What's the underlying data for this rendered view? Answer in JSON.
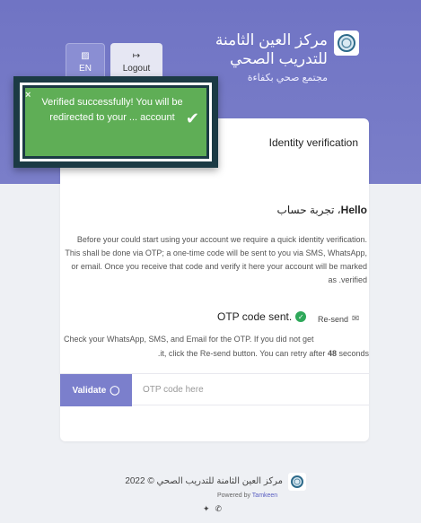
{
  "header": {
    "brand_title": "مركز العين الثامنة للتدريب الصحي",
    "brand_subtitle": "مجتمع صحي بكفاءة",
    "lang_button": "EN",
    "logout_button": "Logout",
    "lang_icon": "translate-icon",
    "logout_icon": "logout-icon"
  },
  "toast": {
    "message": "Verified successfully! You will be redirected to your ... account",
    "close_glyph": "×",
    "check_glyph": "✔",
    "color": "#5fae56"
  },
  "card": {
    "title": "Identity verification",
    "greeting_hello": "Hello",
    "greeting_name": "، تجربة حساب",
    "intro": "Before your could start using your account we require a quick identity verification. This shall be done via OTP; a one-time code will be sent to you via SMS, WhatsApp, or email. Once you receive that code and verify it here your account will be marked as .verified",
    "otp_sent": ".OTP code sent",
    "resend": "Re-send",
    "check_line1": "Check your WhatsApp, SMS, and Email for the OTP. If you did not get",
    "check_line2_prefix": ".it, click the Re-send button. You can retry after",
    "check_seconds": "48",
    "check_line2_suffix": "seconds",
    "validate_button": "Validate",
    "otp_placeholder": "OTP code here"
  },
  "footer": {
    "copyright": "مركز العين الثامنة للتدريب الصحي © 2022",
    "powered_by": "Powered by",
    "powered_link": "Tamkeen",
    "social_icons": [
      "twitter-icon",
      "whatsapp-icon"
    ]
  },
  "colors": {
    "accent": "#7b7fcc",
    "success": "#2ea85a"
  }
}
